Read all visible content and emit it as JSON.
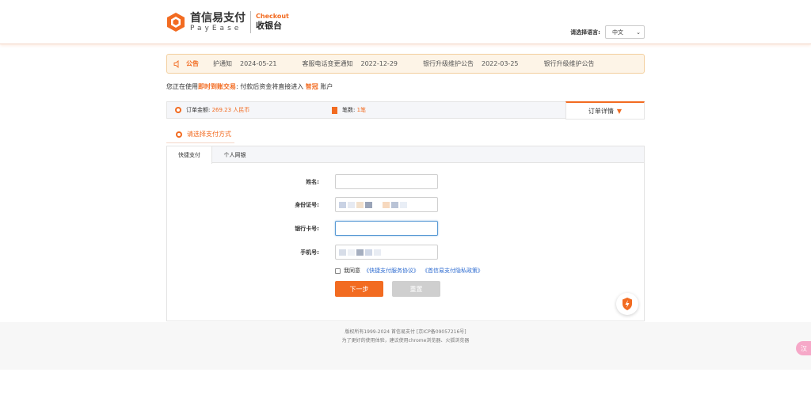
{
  "header": {
    "logo_cn": "首信易支付",
    "logo_en": "PayEase",
    "checkout_en": "Checkout",
    "checkout_cn": "收银台",
    "lang_label": "请选择语言:",
    "lang_value": "中文"
  },
  "notice": {
    "label": "公告",
    "items": [
      {
        "title": "护通知",
        "date": "2024-05-21"
      },
      {
        "title": "客服电话变更通知",
        "date": "2022-12-29"
      },
      {
        "title": "银行升级维护公告",
        "date": "2022-03-25"
      },
      {
        "title": "银行升级维护公告",
        "date": ""
      }
    ]
  },
  "using": {
    "prefix": "您正在使用",
    "mode": "即时到账交易",
    "middle": ": 付款后资金将直接进入",
    "merchant": "智冠",
    "suffix": "账户"
  },
  "order": {
    "amount_label": "订单金额:",
    "amount_value": "269.23 人民币",
    "count_label": "笔数:",
    "count_value": "1笔",
    "detail_label": "订单详情",
    "detail_arrow": "▼"
  },
  "choose_label": "请选择支付方式",
  "tabs": [
    {
      "label": "快捷支付"
    },
    {
      "label": "个人网银"
    }
  ],
  "form": {
    "name_label": "姓名:",
    "id_label": "身份证号:",
    "card_label": "银行卡号:",
    "phone_label": "手机号:",
    "agree_prefix": "我同意",
    "agree_link1": "《快捷支付服务协议》",
    "agree_link2": "《首信易支付隐私政策》",
    "next_label": "下一步",
    "reset_label": "重置"
  },
  "footer": {
    "line1": "版权所有1999-2024 首信易支付 [京ICP备09057216号]",
    "line2": "为了更好的使用体验，建议使用chrome浏览器、火狐浏览器"
  },
  "side_tab": "汉"
}
